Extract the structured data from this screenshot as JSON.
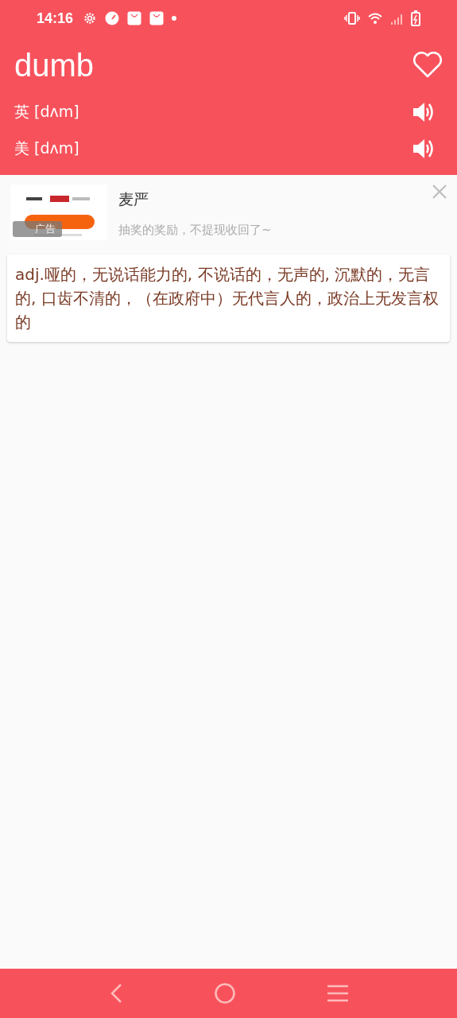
{
  "status_bar": {
    "time": "14:16"
  },
  "word": {
    "title": "dumb",
    "favorited": false
  },
  "pronunciations": [
    {
      "label": "英 [dʌm]"
    },
    {
      "label": "美 [dʌm]"
    }
  ],
  "ad": {
    "badge": "广告",
    "title": "麦严",
    "description": "抽奖的奖励，不提现收回了~"
  },
  "definition": "adj.哑的，无说话能力的, 不说话的，无声的, 沉默的，无言的, 口齿不清的，（在政府中）无代言人的，政治上无发言权的"
}
